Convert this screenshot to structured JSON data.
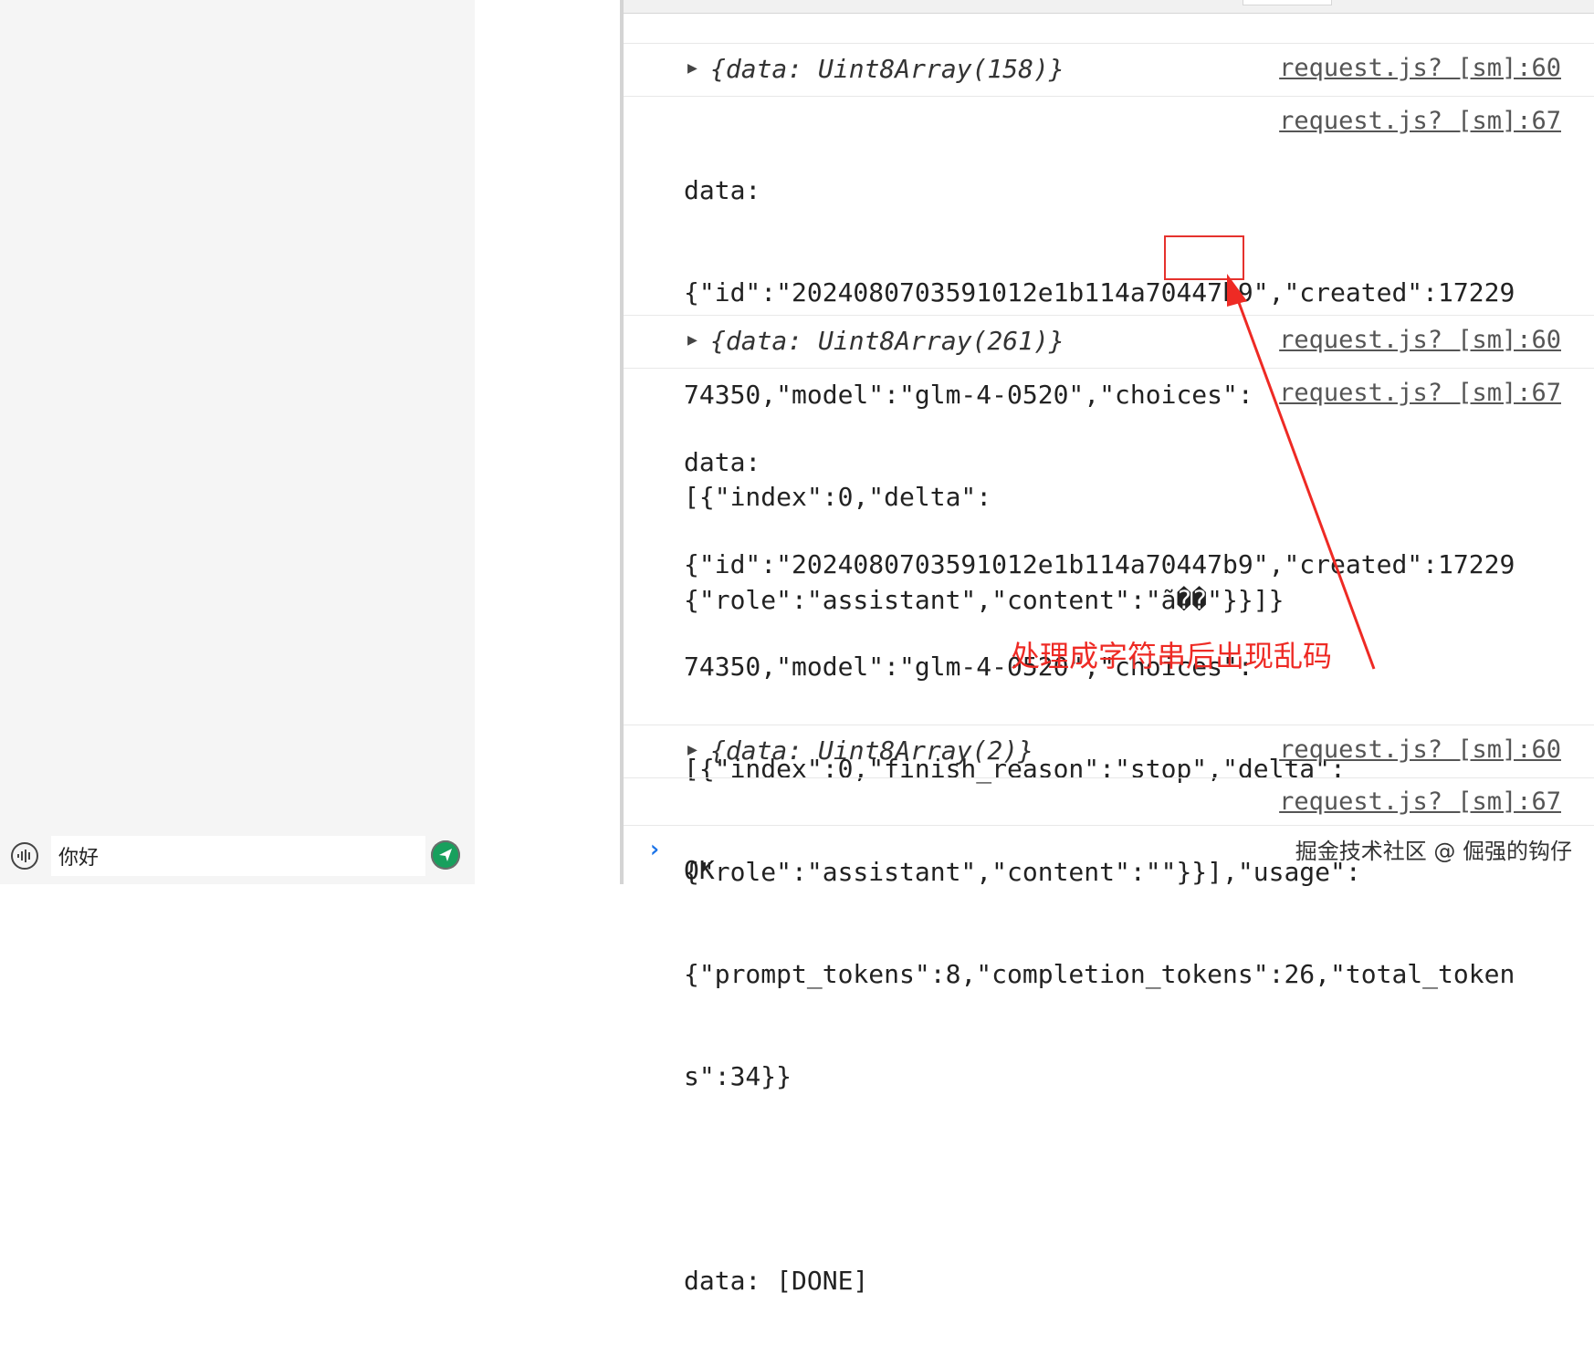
{
  "chat": {
    "input_value": "你好",
    "voice_icon": "voice-wave-icon",
    "send_icon": "send-icon"
  },
  "console": {
    "entries": [
      {
        "type": "object",
        "text": "{data: Uint8Array(158)}",
        "source": "request.js? [sm]:60"
      },
      {
        "type": "log",
        "lines": [
          "data:",
          "{\"id\":\"2024080703591012e1b114a70447b9\",\"created\":17229",
          "74350,\"model\":\"glm-4-0520\",\"choices\":",
          "[{\"index\":0,\"delta\":",
          "{\"role\":\"assistant\",\"content\":\"ã��\"}}]}"
        ],
        "source": "request.js? [sm]:67"
      },
      {
        "type": "object",
        "text": "{data: Uint8Array(261)}",
        "source": "request.js? [sm]:60"
      },
      {
        "type": "log",
        "lines": [
          "data:",
          "{\"id\":\"2024080703591012e1b114a70447b9\",\"created\":17229",
          "74350,\"model\":\"glm-4-0520\",\"choices\":",
          "[{\"index\":0,\"finish_reason\":\"stop\",\"delta\":",
          "{\"role\":\"assistant\",\"content\":\"\"}}],\"usage\":",
          "{\"prompt_tokens\":8,\"completion_tokens\":26,\"total_token",
          "s\":34}}",
          "",
          "data: [DONE]"
        ],
        "source": "request.js? [sm]:67"
      },
      {
        "type": "object",
        "text": "{data: Uint8Array(2)}",
        "source": "request.js? [sm]:60"
      },
      {
        "type": "log",
        "lines": [
          "OK"
        ],
        "source": "request.js? [sm]:67"
      }
    ],
    "prompt_symbol": "›"
  },
  "annotation": {
    "text": "处理成字符串后出现乱码",
    "color": "#ee2a24"
  },
  "watermark": "掘金技术社区 @ 倔强的钩仔"
}
